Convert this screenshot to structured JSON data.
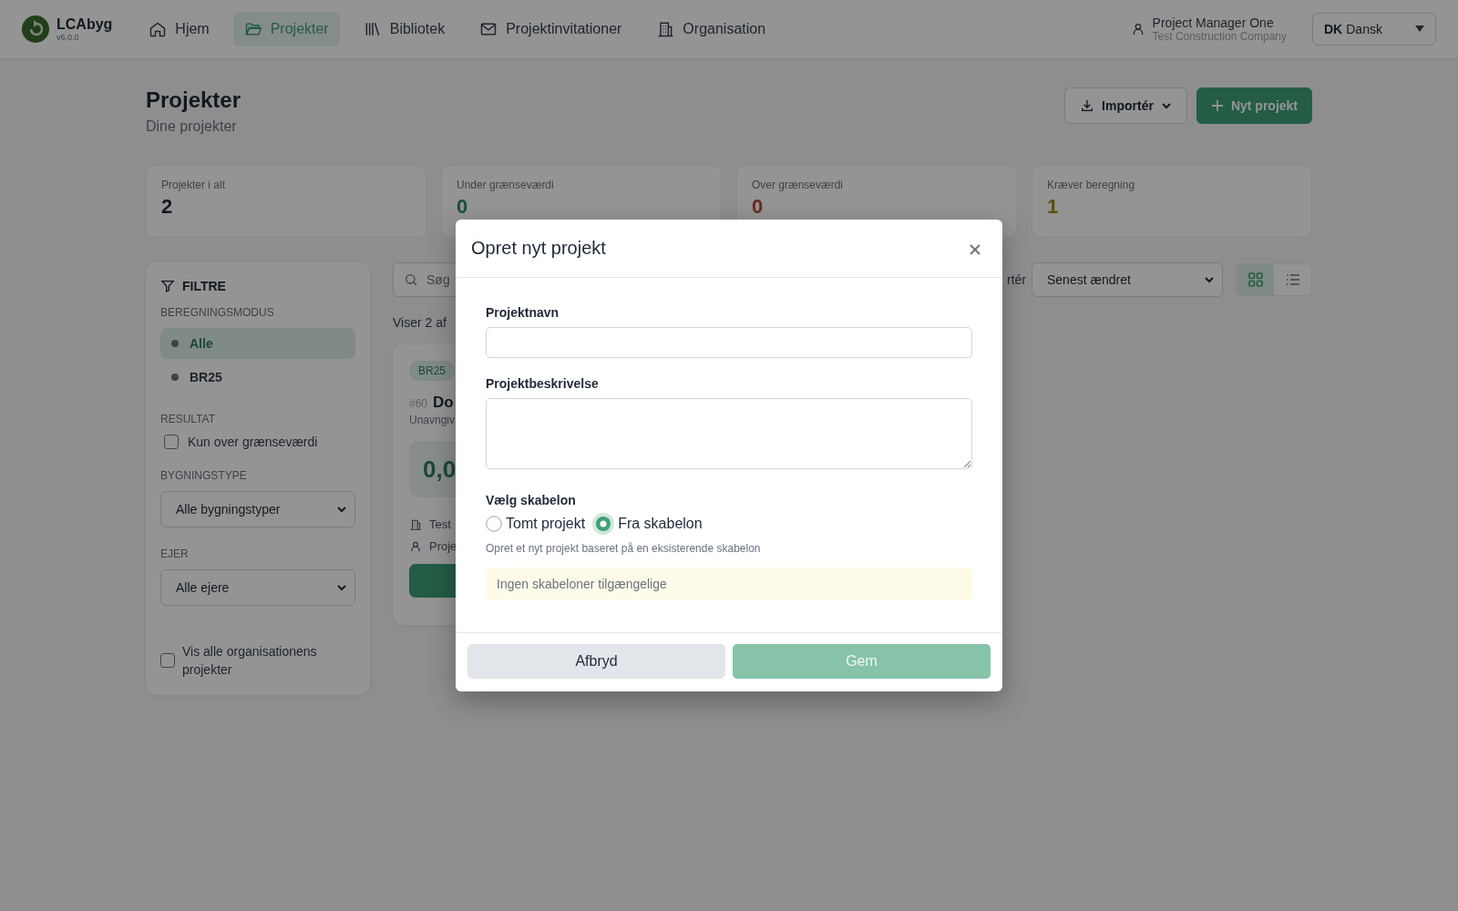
{
  "app": {
    "name": "LCAbyg",
    "version": "v6.0.0"
  },
  "nav": [
    {
      "label": "Hjem",
      "selected": false
    },
    {
      "label": "Projekter",
      "selected": true
    },
    {
      "label": "Bibliotek",
      "selected": false
    },
    {
      "label": "Projektinvitationer",
      "selected": false
    },
    {
      "label": "Organisation",
      "selected": false
    }
  ],
  "user": {
    "name": "Project Manager One",
    "company": "Test Construction Company"
  },
  "language": {
    "code": "DK",
    "label": "Dansk"
  },
  "page": {
    "title": "Projekter",
    "subtitle": "Dine projekter"
  },
  "actions": [
    {
      "kind": "import",
      "label": "Importér"
    },
    {
      "kind": "new",
      "label": "Nyt projekt"
    }
  ],
  "stats": [
    {
      "label": "Projekter i alt",
      "value": "2",
      "color": "#121820"
    },
    {
      "label": "Under grænseværdi",
      "value": "0",
      "color": "#1b503c"
    },
    {
      "label": "Over grænseværdi",
      "value": "0",
      "color": "#6b2b23"
    },
    {
      "label": "Kræver beregning",
      "value": "1",
      "color": "#5d4e09"
    }
  ],
  "filters": {
    "title": "FILTRE",
    "mode_heading": "BEREGNINGSMODUS",
    "modes": [
      {
        "label": "Alle",
        "selected": true
      },
      {
        "label": "BR25",
        "selected": false
      }
    ],
    "result_heading": "RESULTAT",
    "result_options": [
      {
        "label": "Kun over grænseværdi",
        "checked": false
      }
    ],
    "building_heading": "BYGNINGSTYPE",
    "building_value": "Alle bygningstyper",
    "owner_heading": "EJER",
    "owner_value": "Alle ejere",
    "show_all": {
      "label": "Vis alle organisationens projekter",
      "checked": false
    }
  },
  "toolbar": {
    "search_placeholder": "Søg",
    "sort_label": "rtér",
    "sort_value": "Senest ændret",
    "views": [
      {
        "kind": "grid",
        "selected": true
      },
      {
        "kind": "list",
        "selected": false
      }
    ]
  },
  "result_count": "Viser 2 af",
  "project_card": {
    "badge": "BR25",
    "number": "#60",
    "name": "Do",
    "subtitle": "Unavngiv",
    "value": "0,0",
    "company": "Test",
    "owner": "Proje"
  },
  "modal": {
    "title": "Opret nyt projekt",
    "fields": [
      {
        "label": "Projektnavn",
        "kind": "input"
      },
      {
        "label": "Projektbeskrivelse",
        "kind": "textarea"
      }
    ],
    "template_heading": "Vælg skabelon",
    "template_options": [
      {
        "label": "Tomt projekt",
        "selected": false
      },
      {
        "label": "Fra skabelon",
        "selected": true
      }
    ],
    "hint": "Opret et nyt projekt baseret på en eksisterende skabelon",
    "notice": "Ingen skabeloner tilgængelige",
    "buttons": [
      {
        "kind": "cancel",
        "label": "Afbryd",
        "disabled": false
      },
      {
        "kind": "primary",
        "label": "Gem",
        "disabled": true
      }
    ]
  }
}
